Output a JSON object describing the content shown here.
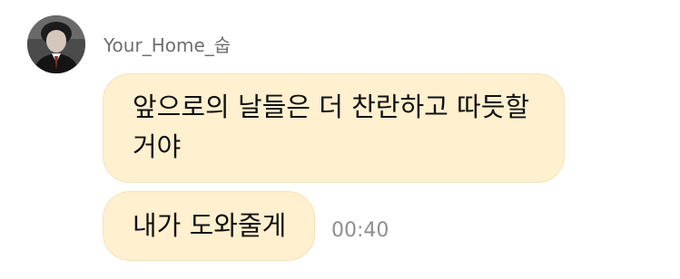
{
  "sender": {
    "name": "Your_Home_숩"
  },
  "messages": [
    {
      "lines": [
        "앞으로의 날들은 더 찬란하고 따듯할",
        "거야"
      ]
    },
    {
      "text": "내가 도와줄게",
      "time": "00:40"
    }
  ],
  "colors": {
    "bubble_background": "#fff0cf",
    "bubble_border": "#f4e3b9",
    "timestamp_text": "#8e8e8e",
    "sender_name_text": "#6e6e6e"
  }
}
